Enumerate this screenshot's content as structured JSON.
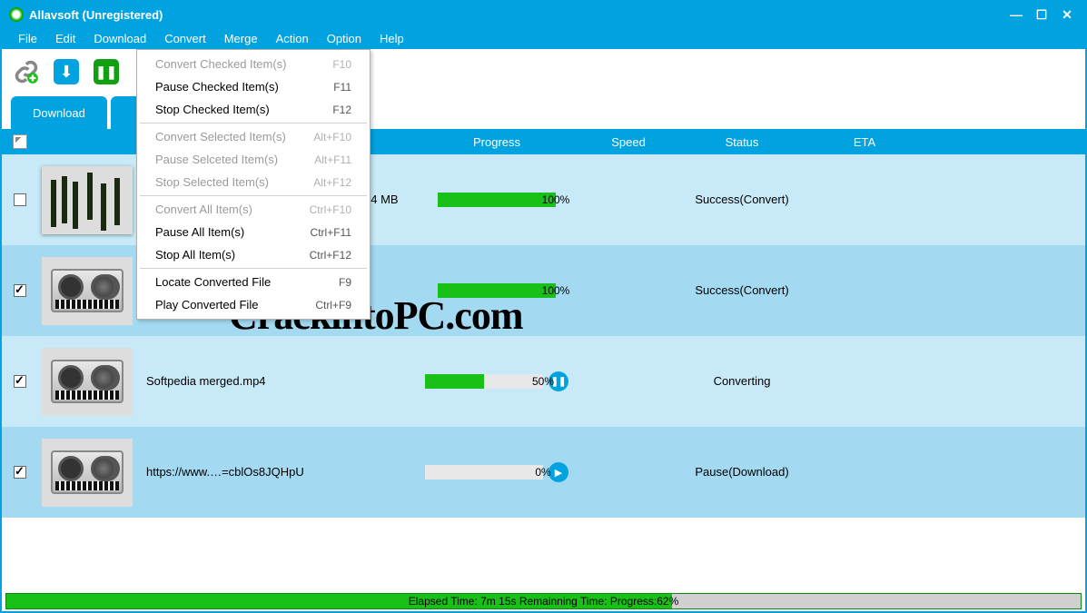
{
  "window": {
    "title": "Allavsoft (Unregistered)"
  },
  "menubar": [
    "File",
    "Edit",
    "Download",
    "Convert",
    "Merge",
    "Action",
    "Option",
    "Help"
  ],
  "tabs": {
    "download": "Download"
  },
  "table": {
    "headers": {
      "progress": "Progress",
      "speed": "Speed",
      "status": "Status",
      "eta": "ETA"
    }
  },
  "dropdown": {
    "items": [
      {
        "label": "Convert Checked Item(s)",
        "shortcut": "F10",
        "disabled": true
      },
      {
        "label": "Pause Checked Item(s)",
        "shortcut": "F11",
        "disabled": false
      },
      {
        "label": "Stop Checked Item(s)",
        "shortcut": "F12",
        "disabled": false
      },
      {
        "sep": true
      },
      {
        "label": "Convert Selected Item(s)",
        "shortcut": "Alt+F10",
        "disabled": true
      },
      {
        "label": "Pause Selceted Item(s)",
        "shortcut": "Alt+F11",
        "disabled": true
      },
      {
        "label": "Stop Selected Item(s)",
        "shortcut": "Alt+F12",
        "disabled": true
      },
      {
        "sep": true
      },
      {
        "label": "Convert All Item(s)",
        "shortcut": "Ctrl+F10",
        "disabled": true
      },
      {
        "label": "Pause All Item(s)",
        "shortcut": "Ctrl+F11",
        "disabled": false
      },
      {
        "label": "Stop All Item(s)",
        "shortcut": "Ctrl+F12",
        "disabled": false
      },
      {
        "sep": true
      },
      {
        "label": "Locate Converted File",
        "shortcut": "F9",
        "disabled": false
      },
      {
        "label": "Play Converted File",
        "shortcut": "Ctrl+F9",
        "disabled": false
      }
    ]
  },
  "rows": [
    {
      "checked": false,
      "thumb": "forest",
      "name": "",
      "size": "24 MB",
      "progress": 100,
      "progress_text": "100%",
      "action": "",
      "status": "Success(Convert)"
    },
    {
      "checked": true,
      "thumb": "reel",
      "name": "",
      "size": "",
      "progress": 100,
      "progress_text": "100%",
      "action": "",
      "status": "Success(Convert)"
    },
    {
      "checked": true,
      "thumb": "reel",
      "name": "Softpedia merged.mp4",
      "size": "",
      "progress": 50,
      "progress_text": "50%",
      "action": "pause",
      "status": "Converting"
    },
    {
      "checked": true,
      "thumb": "reel",
      "name": "https://www.…=cblOs8JQHpU",
      "size": "",
      "progress": 0,
      "progress_text": "0%",
      "action": "play",
      "status": "Pause(Download)"
    }
  ],
  "statusbar": {
    "text": "Elapsed Time: 7m 15s Remainning Time: Progress:62%",
    "percent": 62
  },
  "watermark": "CrackintoPC.com"
}
